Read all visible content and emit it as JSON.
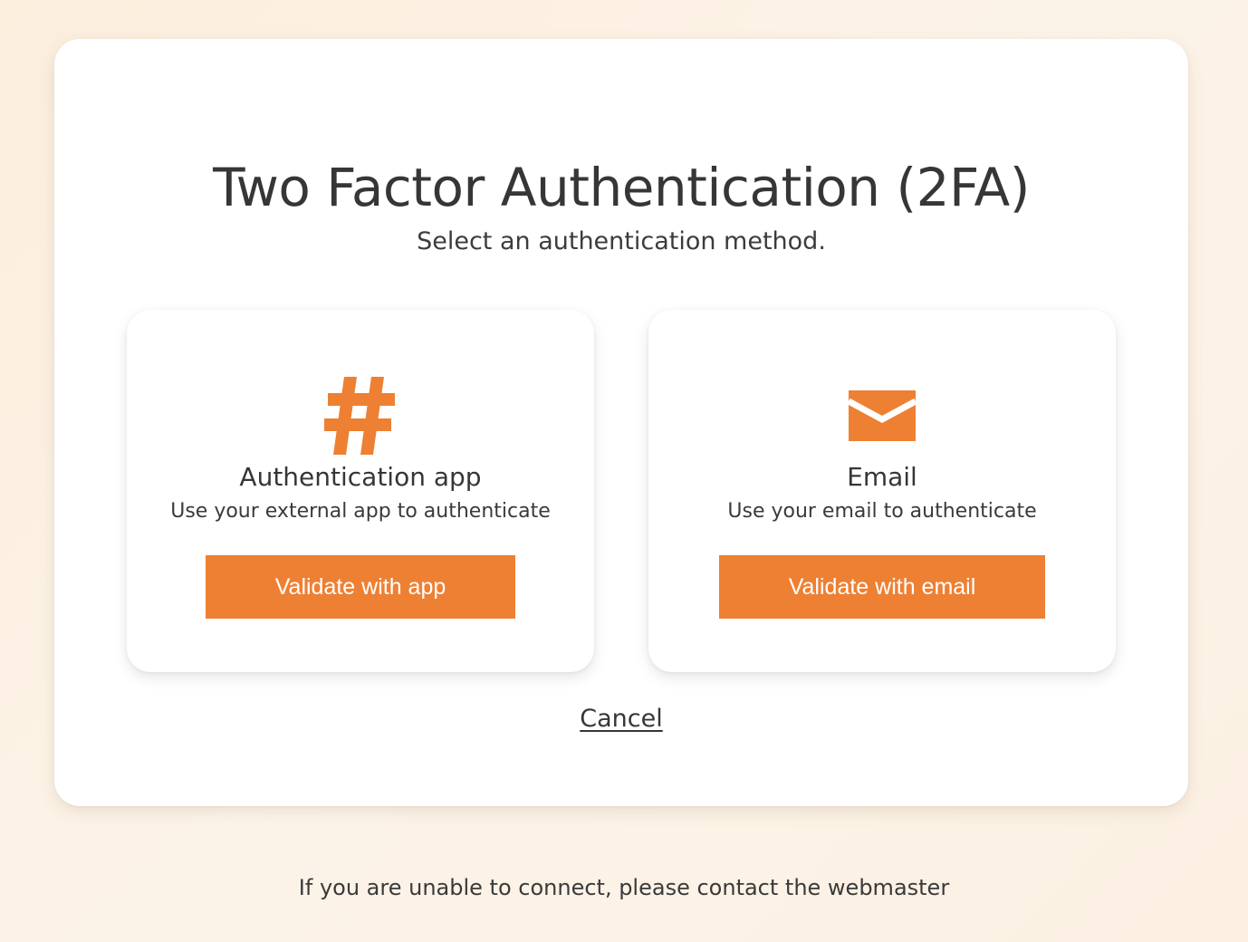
{
  "header": {
    "title": "Two Factor Authentication (2FA)",
    "subtitle": "Select an authentication method."
  },
  "methods": [
    {
      "icon": "hashtag-icon",
      "title": "Authentication app",
      "description": "Use your external app to authenticate",
      "button_label": "Validate with app"
    },
    {
      "icon": "envelope-icon",
      "title": "Email",
      "description": "Use your email to authenticate",
      "button_label": "Validate with email"
    }
  ],
  "cancel_label": "Cancel",
  "footer": {
    "note": "If you are unable to connect, please contact the webmaster"
  },
  "colors": {
    "accent": "#ee8033",
    "background": "#fbeedd",
    "card": "#ffffff",
    "text": "#363636"
  }
}
